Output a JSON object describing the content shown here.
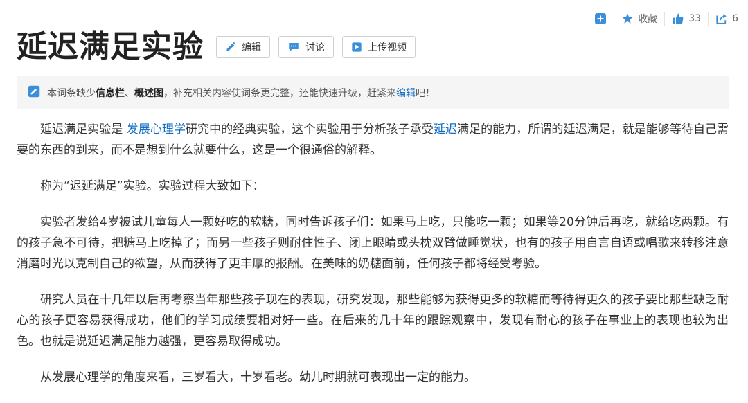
{
  "top_actions": {
    "collect_label": "收藏",
    "like_count": "33",
    "share_count": "6"
  },
  "title": "延迟满足实验",
  "buttons": {
    "edit": "编辑",
    "discuss": "讨论",
    "upload_video": "上传视频"
  },
  "notice": {
    "prefix": "本词条缺少",
    "bold1": "信息栏",
    "sep": "、",
    "bold2": "概述图",
    "middle": "，补充相关内容使词条更完整，还能快速升级，赶紧来",
    "link": "编辑",
    "suffix": "吧！"
  },
  "paragraphs": {
    "p1": {
      "a": "延迟满足实验是 ",
      "link1": "发展心理学",
      "b": "研究中的经典实验，这个实验用于分析孩子承受",
      "link2": "延迟",
      "c": "满足的能力，所谓的延迟满足，就是能够等待自己需要的东西的到来，而不是想到什么就要什么，这是一个很通俗的解释。"
    },
    "p2": "称为“迟延满足”实验。实验过程大致如下：",
    "p3": "实验者发给4岁被试儿童每人一颗好吃的软糖，同时告诉孩子们：如果马上吃，只能吃一颗；如果等20分钟后再吃，就给吃两颗。有的孩子急不可待，把糖马上吃掉了；而另一些孩子则耐住性子、闭上眼睛或头枕双臂做睡觉状，也有的孩子用自言自语或唱歌来转移注意消磨时光以克制自己的欲望，从而获得了更丰厚的报酬。在美味的奶糖面前，任何孩子都将经受考验。",
    "p4": "研究人员在十几年以后再考察当年那些孩子现在的表现，研究发现，那些能够为获得更多的软糖而等待得更久的孩子要比那些缺乏耐心的孩子更容易获得成功，他们的学习成绩要相对好一些。在后来的几十年的跟踪观察中，发现有耐心的孩子在事业上的表现也较为出色。也就是说延迟满足能力越强，更容易取得成功。",
    "p5": "从发展心理学的角度来看，三岁看大，十岁看老。幼儿时期就可表现出一定的能力。"
  },
  "colors": {
    "link": "#136ec2",
    "icon_blue": "#3b8fd9",
    "notice_bg": "#f5f5f5"
  },
  "icons": [
    "add-icon",
    "star-icon",
    "thumbs-up-icon",
    "share-icon",
    "pencil-icon",
    "comment-icon",
    "video-icon",
    "edit-notice-icon"
  ]
}
